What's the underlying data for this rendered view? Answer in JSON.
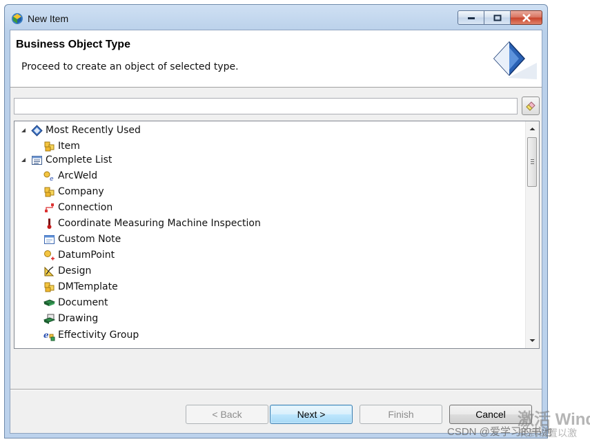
{
  "window": {
    "title": "New Item"
  },
  "header": {
    "title": "Business Object Type",
    "description": "Proceed to create an object of selected type."
  },
  "filter": {
    "value": "",
    "placeholder": ""
  },
  "tree": {
    "groups": [
      {
        "label": "Most Recently Used",
        "icon": "mru-diamond-icon",
        "expanded": true
      },
      {
        "label": "Complete List",
        "icon": "list-icon",
        "expanded": true
      }
    ],
    "items": [
      {
        "label": "Item",
        "icon": "item-cubes-icon"
      },
      {
        "label": "ArcWeld",
        "icon": "arcweld-icon"
      },
      {
        "label": "Company",
        "icon": "company-cubes-icon"
      },
      {
        "label": "Connection",
        "icon": "connection-icon"
      },
      {
        "label": "Coordinate Measuring Machine Inspection",
        "icon": "cmm-probe-icon"
      },
      {
        "label": "Custom Note",
        "icon": "custom-note-icon"
      },
      {
        "label": "DatumPoint",
        "icon": "datum-point-icon"
      },
      {
        "label": "Design",
        "icon": "design-icon"
      },
      {
        "label": "DMTemplate",
        "icon": "dmtemplate-cubes-icon"
      },
      {
        "label": "Document",
        "icon": "document-icon"
      },
      {
        "label": "Drawing",
        "icon": "drawing-icon"
      },
      {
        "label": "Effectivity Group",
        "icon": "effectivity-group-icon"
      }
    ]
  },
  "buttons": {
    "back": "< Back",
    "next": "Next >",
    "finish": "Finish",
    "cancel": "Cancel"
  },
  "watermarks": {
    "activate": "激活 Wind",
    "activate_sub": "转到设置以激",
    "csdn": "CSDN @爱学习的书池"
  },
  "colors": {
    "title_gradient": "#b9d0ea",
    "default_button": "#3c7fb1",
    "close_button": "#c8422a"
  }
}
